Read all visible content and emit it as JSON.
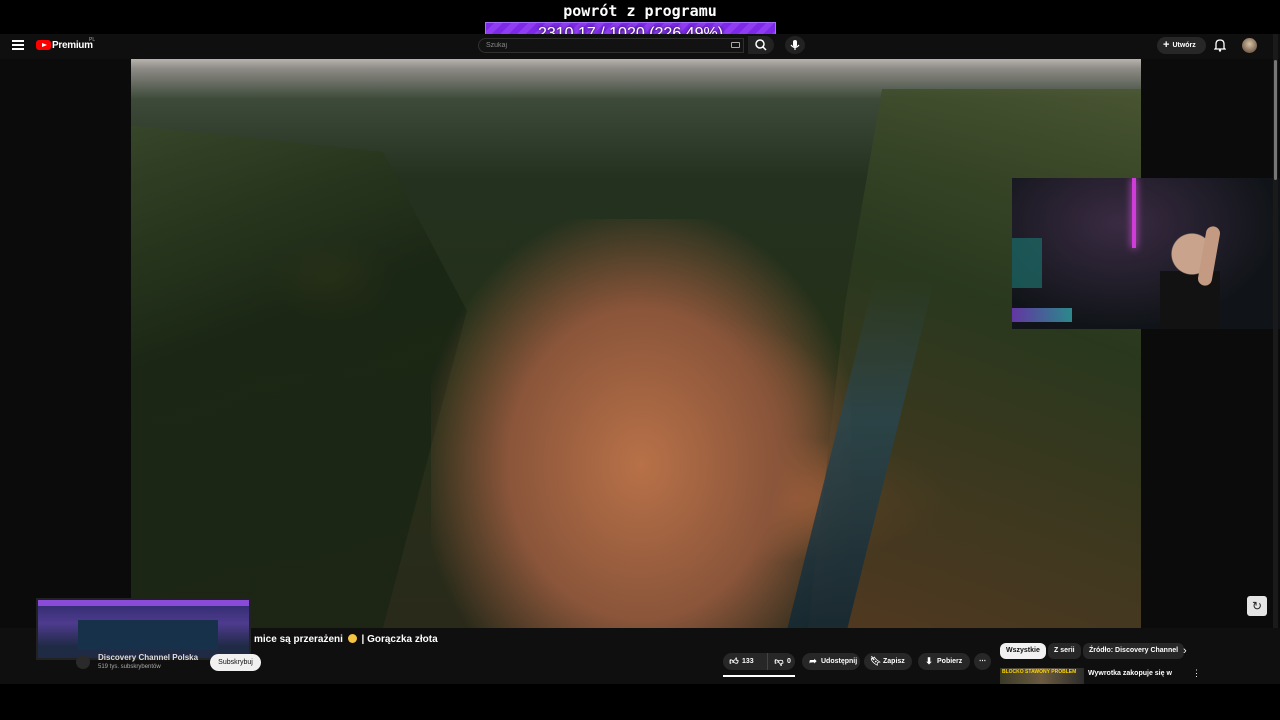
{
  "overlay": {
    "title": "powrót z programu",
    "progress_text": "2310.17 / 1020 (226.49%)",
    "progress_percent": 226.49,
    "accent": "#8f3cf2"
  },
  "header": {
    "menu_icon": "hamburger-icon",
    "brand": "Premium",
    "country": "PL",
    "search_placeholder": "Szukaj",
    "create_label": "Utwórz",
    "icons": [
      "search-icon",
      "mic-icon",
      "keyboard-icon",
      "bell-icon"
    ]
  },
  "video": {
    "title_visible": "mice są przerażeni",
    "title_suffix": "| Gorączka złota",
    "channel_name": "Discovery Channel Polska",
    "subscribers": "519 tys. subskrybentów",
    "subscribe_label": "Subskrybuj"
  },
  "actions": {
    "likes": "133",
    "dislikes": "0",
    "share": "Udostępnij",
    "save": "Zapisz",
    "download": "Pobierz"
  },
  "sidebar": {
    "chips": [
      "Wszystkie",
      "Z serii",
      "Źródło: Discovery Channel"
    ],
    "active_chip": "Wszystkie",
    "recommendation": {
      "thumb_text": "BLOCKO STAWONY PROBLEM",
      "title": "Wywrotka zakopuje się w"
    }
  },
  "colors": {
    "youtube_red": "#ff0000",
    "bg": "#0f0f0f",
    "pill": "#272727"
  }
}
